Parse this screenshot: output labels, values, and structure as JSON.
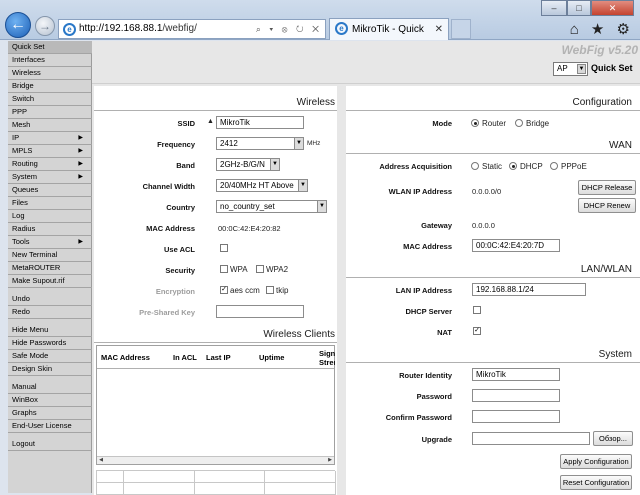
{
  "browser": {
    "url_host": "http://192.168.88.1",
    "url_path": "/webfig/",
    "tab_title": "MikroTik - Quick Set...",
    "addr_icons": "⌕ ▾ ⊗ ↻ ✕",
    "tool_icons": "⌂ ★ ⚙",
    "win_buttons": [
      "–",
      "□",
      "✕"
    ]
  },
  "sidebar": {
    "items": [
      {
        "label": "Quick Set",
        "arrow": ""
      },
      {
        "label": "Interfaces",
        "arrow": ""
      },
      {
        "label": "Wireless",
        "arrow": ""
      },
      {
        "label": "Bridge",
        "arrow": ""
      },
      {
        "label": "Switch",
        "arrow": ""
      },
      {
        "label": "PPP",
        "arrow": ""
      },
      {
        "label": "Mesh",
        "arrow": ""
      },
      {
        "label": "IP",
        "arrow": "▶"
      },
      {
        "label": "MPLS",
        "arrow": "▶"
      },
      {
        "label": "Routing",
        "arrow": "▶"
      },
      {
        "label": "System",
        "arrow": "▶"
      },
      {
        "label": "Queues",
        "arrow": ""
      },
      {
        "label": "Files",
        "arrow": ""
      },
      {
        "label": "Log",
        "arrow": ""
      },
      {
        "label": "Radius",
        "arrow": ""
      },
      {
        "label": "Tools",
        "arrow": "▶"
      },
      {
        "label": "New Terminal",
        "arrow": ""
      },
      {
        "label": "MetaROUTER",
        "arrow": ""
      },
      {
        "label": "Make Supout.rif",
        "arrow": ""
      },
      {
        "label": "Undo",
        "arrow": ""
      },
      {
        "label": "Redo",
        "arrow": ""
      },
      {
        "label": "Hide Menu",
        "arrow": ""
      },
      {
        "label": "Hide Passwords",
        "arrow": ""
      },
      {
        "label": "Safe Mode",
        "arrow": ""
      },
      {
        "label": "Design Skin",
        "arrow": ""
      },
      {
        "label": "Manual",
        "arrow": ""
      },
      {
        "label": "WinBox",
        "arrow": ""
      },
      {
        "label": "Graphs",
        "arrow": ""
      },
      {
        "label": "End-User License",
        "arrow": ""
      },
      {
        "label": "Logout",
        "arrow": ""
      }
    ]
  },
  "header": {
    "logo": "WebFig v5.20",
    "mode_value": "AP",
    "title": "Quick Set"
  },
  "wireless": {
    "title": "Wireless",
    "ssid_label": "SSID",
    "ssid_toggle": "▲",
    "ssid_value": "MikroTik",
    "frequency_label": "Frequency",
    "frequency_value": "2412",
    "frequency_unit": "MHz",
    "band_label": "Band",
    "band_value": "2GHz-B/G/N",
    "channel_width_label": "Channel Width",
    "channel_width_value": "20/40MHz HT Above",
    "country_label": "Country",
    "country_value": "no_country_set",
    "mac_label": "MAC Address",
    "mac_value": "00:0C:42:E4:20:82",
    "use_acl_label": "Use ACL",
    "security_label": "Security",
    "wpa_label": "WPA",
    "wpa2_label": "WPA2",
    "encryption_label": "Encryption",
    "aes_label": "aes ccm",
    "tkip_label": "tkip",
    "psk_label": "Pre-Shared Key"
  },
  "clients": {
    "title": "Wireless Clients",
    "columns": [
      "MAC Address",
      "In ACL",
      "Last IP",
      "Uptime",
      "Signal Strength"
    ]
  },
  "configuration": {
    "title": "Configuration",
    "mode_label": "Mode",
    "mode_router": "Router",
    "mode_bridge": "Bridge"
  },
  "wan": {
    "title": "WAN",
    "acquisition_label": "Address Acquisition",
    "opt_static": "Static",
    "opt_dhcp": "DHCP",
    "opt_pppoe": "PPPoE",
    "wlan_ip_label": "WLAN IP Address",
    "wlan_ip_value": "0.0.0.0/0",
    "dhcp_release": "DHCP Release",
    "dhcp_renew": "DHCP Renew",
    "gateway_label": "Gateway",
    "gateway_value": "0.0.0.0",
    "mac_label": "MAC Address",
    "mac_value": "00:0C:42:E4:20:7D"
  },
  "lan": {
    "title": "LAN/WLAN",
    "ip_label": "LAN IP Address",
    "ip_value": "192.168.88.1/24",
    "dhcp_server_label": "DHCP Server",
    "nat_label": "NAT"
  },
  "system": {
    "title": "System",
    "identity_label": "Router Identity",
    "identity_value": "MikroTik",
    "password_label": "Password",
    "confirm_label": "Confirm Password",
    "upgrade_label": "Upgrade",
    "browse_label": "Обзор...",
    "apply_label": "Apply Configuration",
    "reset_label": "Reset Configuration"
  },
  "checked_mark": "✓"
}
